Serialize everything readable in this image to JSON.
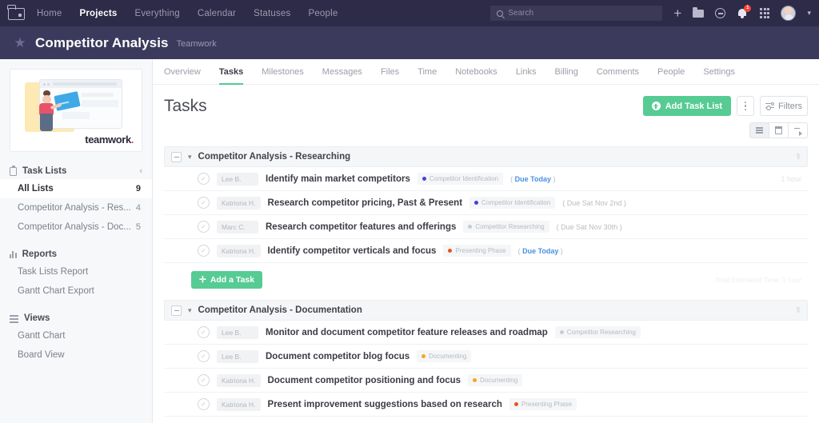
{
  "topnav": {
    "logo_icon": "folder-logo-icon",
    "links": [
      {
        "label": "Home",
        "active": false
      },
      {
        "label": "Projects",
        "active": true
      },
      {
        "label": "Everything",
        "active": false
      },
      {
        "label": "Calendar",
        "active": false
      },
      {
        "label": "Statuses",
        "active": false
      },
      {
        "label": "People",
        "active": false
      }
    ],
    "search": {
      "value": "",
      "placeholder": "Search",
      "icon": "search-icon"
    },
    "icons": [
      "plus-icon",
      "folder-icon",
      "help-circle-icon",
      "bell-icon",
      "apps-grid-icon",
      "avatar",
      "chevron-down-icon"
    ],
    "notification_badge": "1"
  },
  "project_header": {
    "star_icon": "star-icon",
    "title": "Competitor Analysis",
    "subtitle": "Teamwork"
  },
  "sidebar": {
    "promo": {
      "brand": "teamwork",
      "brand_dot": "."
    },
    "sections": [
      {
        "label": "Task Lists",
        "icon": "clipboard-icon",
        "collapse_icon": "chevron-left-icon",
        "items": [
          {
            "label": "All Lists",
            "count": "9",
            "active": true
          },
          {
            "label": "Competitor Analysis - Res...",
            "count": "4",
            "active": false
          },
          {
            "label": "Competitor Analysis - Doc...",
            "count": "5",
            "active": false
          }
        ]
      },
      {
        "label": "Reports",
        "icon": "bar-chart-icon",
        "items": [
          {
            "label": "Task Lists Report",
            "count": "",
            "active": false
          },
          {
            "label": "Gantt Chart Export",
            "count": "",
            "active": false
          }
        ]
      },
      {
        "label": "Views",
        "icon": "views-icon",
        "items": [
          {
            "label": "Gantt Chart",
            "count": "",
            "active": false
          },
          {
            "label": "Board View",
            "count": "",
            "active": false
          }
        ]
      }
    ]
  },
  "main": {
    "tabs": [
      {
        "label": "Overview",
        "active": false
      },
      {
        "label": "Tasks",
        "active": true
      },
      {
        "label": "Milestones",
        "active": false
      },
      {
        "label": "Messages",
        "active": false
      },
      {
        "label": "Files",
        "active": false
      },
      {
        "label": "Time",
        "active": false
      },
      {
        "label": "Notebooks",
        "active": false
      },
      {
        "label": "Links",
        "active": false
      },
      {
        "label": "Billing",
        "active": false
      },
      {
        "label": "Comments",
        "active": false
      },
      {
        "label": "People",
        "active": false
      },
      {
        "label": "Settings",
        "active": false
      }
    ],
    "page_title": "Tasks",
    "actions": {
      "add_task_list": "Add Task List",
      "more_menu": "",
      "filters": "Filters"
    },
    "view_toggle": [
      {
        "name": "list-view",
        "active": true
      },
      {
        "name": "calendar-view",
        "active": false
      },
      {
        "name": "gantt-view",
        "active": false
      }
    ],
    "task_lists": [
      {
        "title": "Competitor Analysis - Researching",
        "tasks": [
          {
            "assignee": "Lee B.",
            "name": "Identify main market competitors",
            "tag": "Competitor Identification",
            "tag_color": "#4b3fd4",
            "due": "Due Today",
            "due_today": true,
            "right": "1 hour"
          },
          {
            "assignee": "Katriona H.",
            "name": "Research competitor pricing, Past & Present",
            "tag": "Competitor Identification",
            "tag_color": "#4b3fd4",
            "due": "Due Sat Nov 2nd",
            "due_today": false,
            "right": ""
          },
          {
            "assignee": "Marc C.",
            "name": "Research competitor features and offerings",
            "tag": "Competitor Researching",
            "tag_color": "#c8ccd2",
            "due": "Due Sat Nov 30th",
            "due_today": false,
            "right": ""
          },
          {
            "assignee": "Katriona H.",
            "name": "Identify competitor verticals and focus",
            "tag": "Presenting Phase",
            "tag_color": "#e8541f",
            "due": "Due Today",
            "due_today": true,
            "right": ""
          }
        ],
        "add_task_label": "Add a Task",
        "estimated_time": "Total Estimated Time: 1 hour"
      },
      {
        "title": "Competitor Analysis - Documentation",
        "tasks": [
          {
            "assignee": "Lee B.",
            "name": "Monitor and document competitor feature releases and roadmap",
            "tag": "Competitor Researching",
            "tag_color": "#c8ccd2",
            "due": "",
            "due_today": false,
            "right": ""
          },
          {
            "assignee": "Lee B.",
            "name": "Document competitor blog focus",
            "tag": "Documenting",
            "tag_color": "#f5a623",
            "due": "",
            "due_today": false,
            "right": ""
          },
          {
            "assignee": "Katriona H.",
            "name": "Document competitor positioning and focus",
            "tag": "Documenting",
            "tag_color": "#f5a623",
            "due": "",
            "due_today": false,
            "right": ""
          },
          {
            "assignee": "Katriona H.",
            "name": "Present improvement suggestions based on research",
            "tag": "Presenting Phase",
            "tag_color": "#e8541f",
            "due": "",
            "due_today": false,
            "right": ""
          }
        ],
        "add_task_label": "",
        "estimated_time": ""
      }
    ]
  },
  "colors": {
    "nav_bg": "#2d2b47",
    "project_bg": "#3c3a5c",
    "accent_green": "#56cb93",
    "link_blue": "#4a90e2"
  }
}
